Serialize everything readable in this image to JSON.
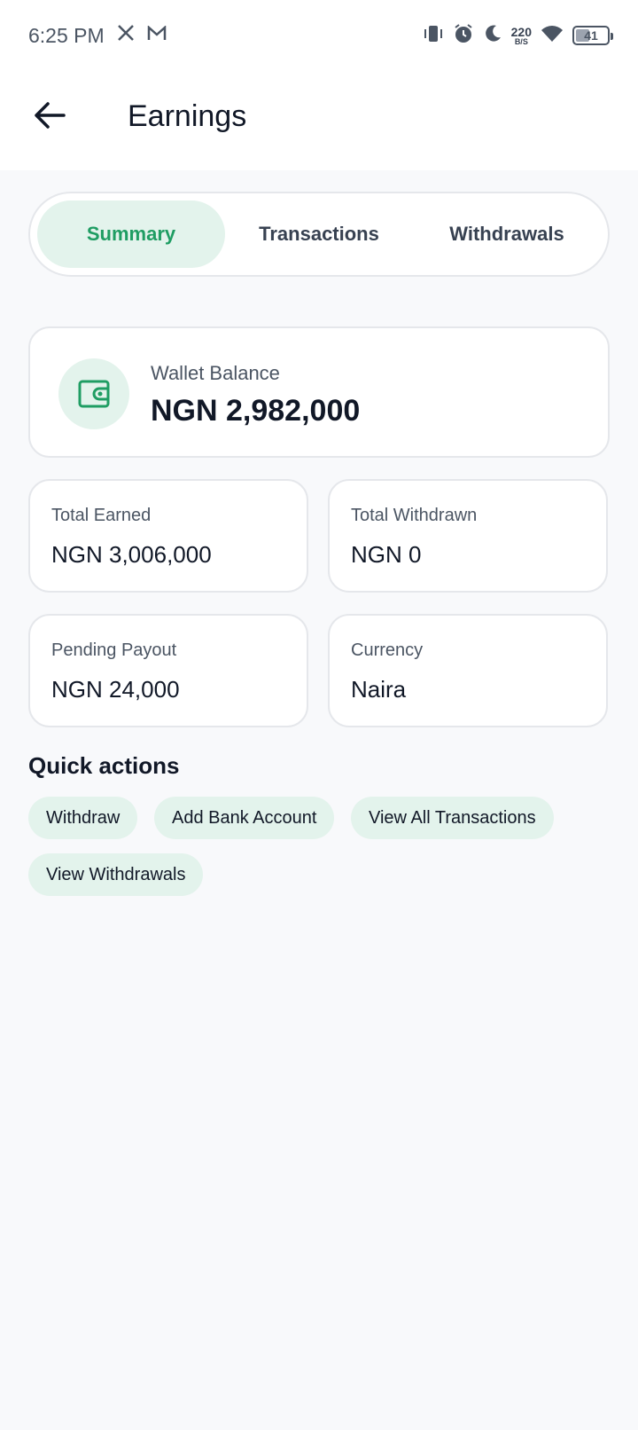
{
  "status_bar": {
    "time": "6:25 PM",
    "net_speed_value": "220",
    "net_speed_unit": "B/S",
    "battery": "41",
    "icons": [
      "x-icon",
      "gmail-icon",
      "vibrate-icon",
      "alarm-icon",
      "moon-icon",
      "wifi-icon",
      "battery-icon"
    ]
  },
  "app_bar": {
    "title": "Earnings",
    "back_icon": "arrow-left-icon"
  },
  "tabs": [
    {
      "label": "Summary",
      "active": true
    },
    {
      "label": "Transactions",
      "active": false
    },
    {
      "label": "Withdrawals",
      "active": false
    }
  ],
  "wallet": {
    "icon": "wallet-icon",
    "label": "Wallet Balance",
    "value": "NGN 2,982,000"
  },
  "stats": [
    {
      "label": "Total Earned",
      "value": "NGN 3,006,000"
    },
    {
      "label": "Total Withdrawn",
      "value": "NGN 0"
    },
    {
      "label": "Pending Payout",
      "value": "NGN 24,000"
    },
    {
      "label": "Currency",
      "value": "Naira"
    }
  ],
  "quick_actions": {
    "title": "Quick actions",
    "items": [
      "Withdraw",
      "Add Bank Account",
      "View All Transactions",
      "View Withdrawals"
    ]
  },
  "colors": {
    "accent": "#1f9d63",
    "accent_bg": "#e3f3ec",
    "background": "#f8f9fb",
    "text": "#111827"
  }
}
